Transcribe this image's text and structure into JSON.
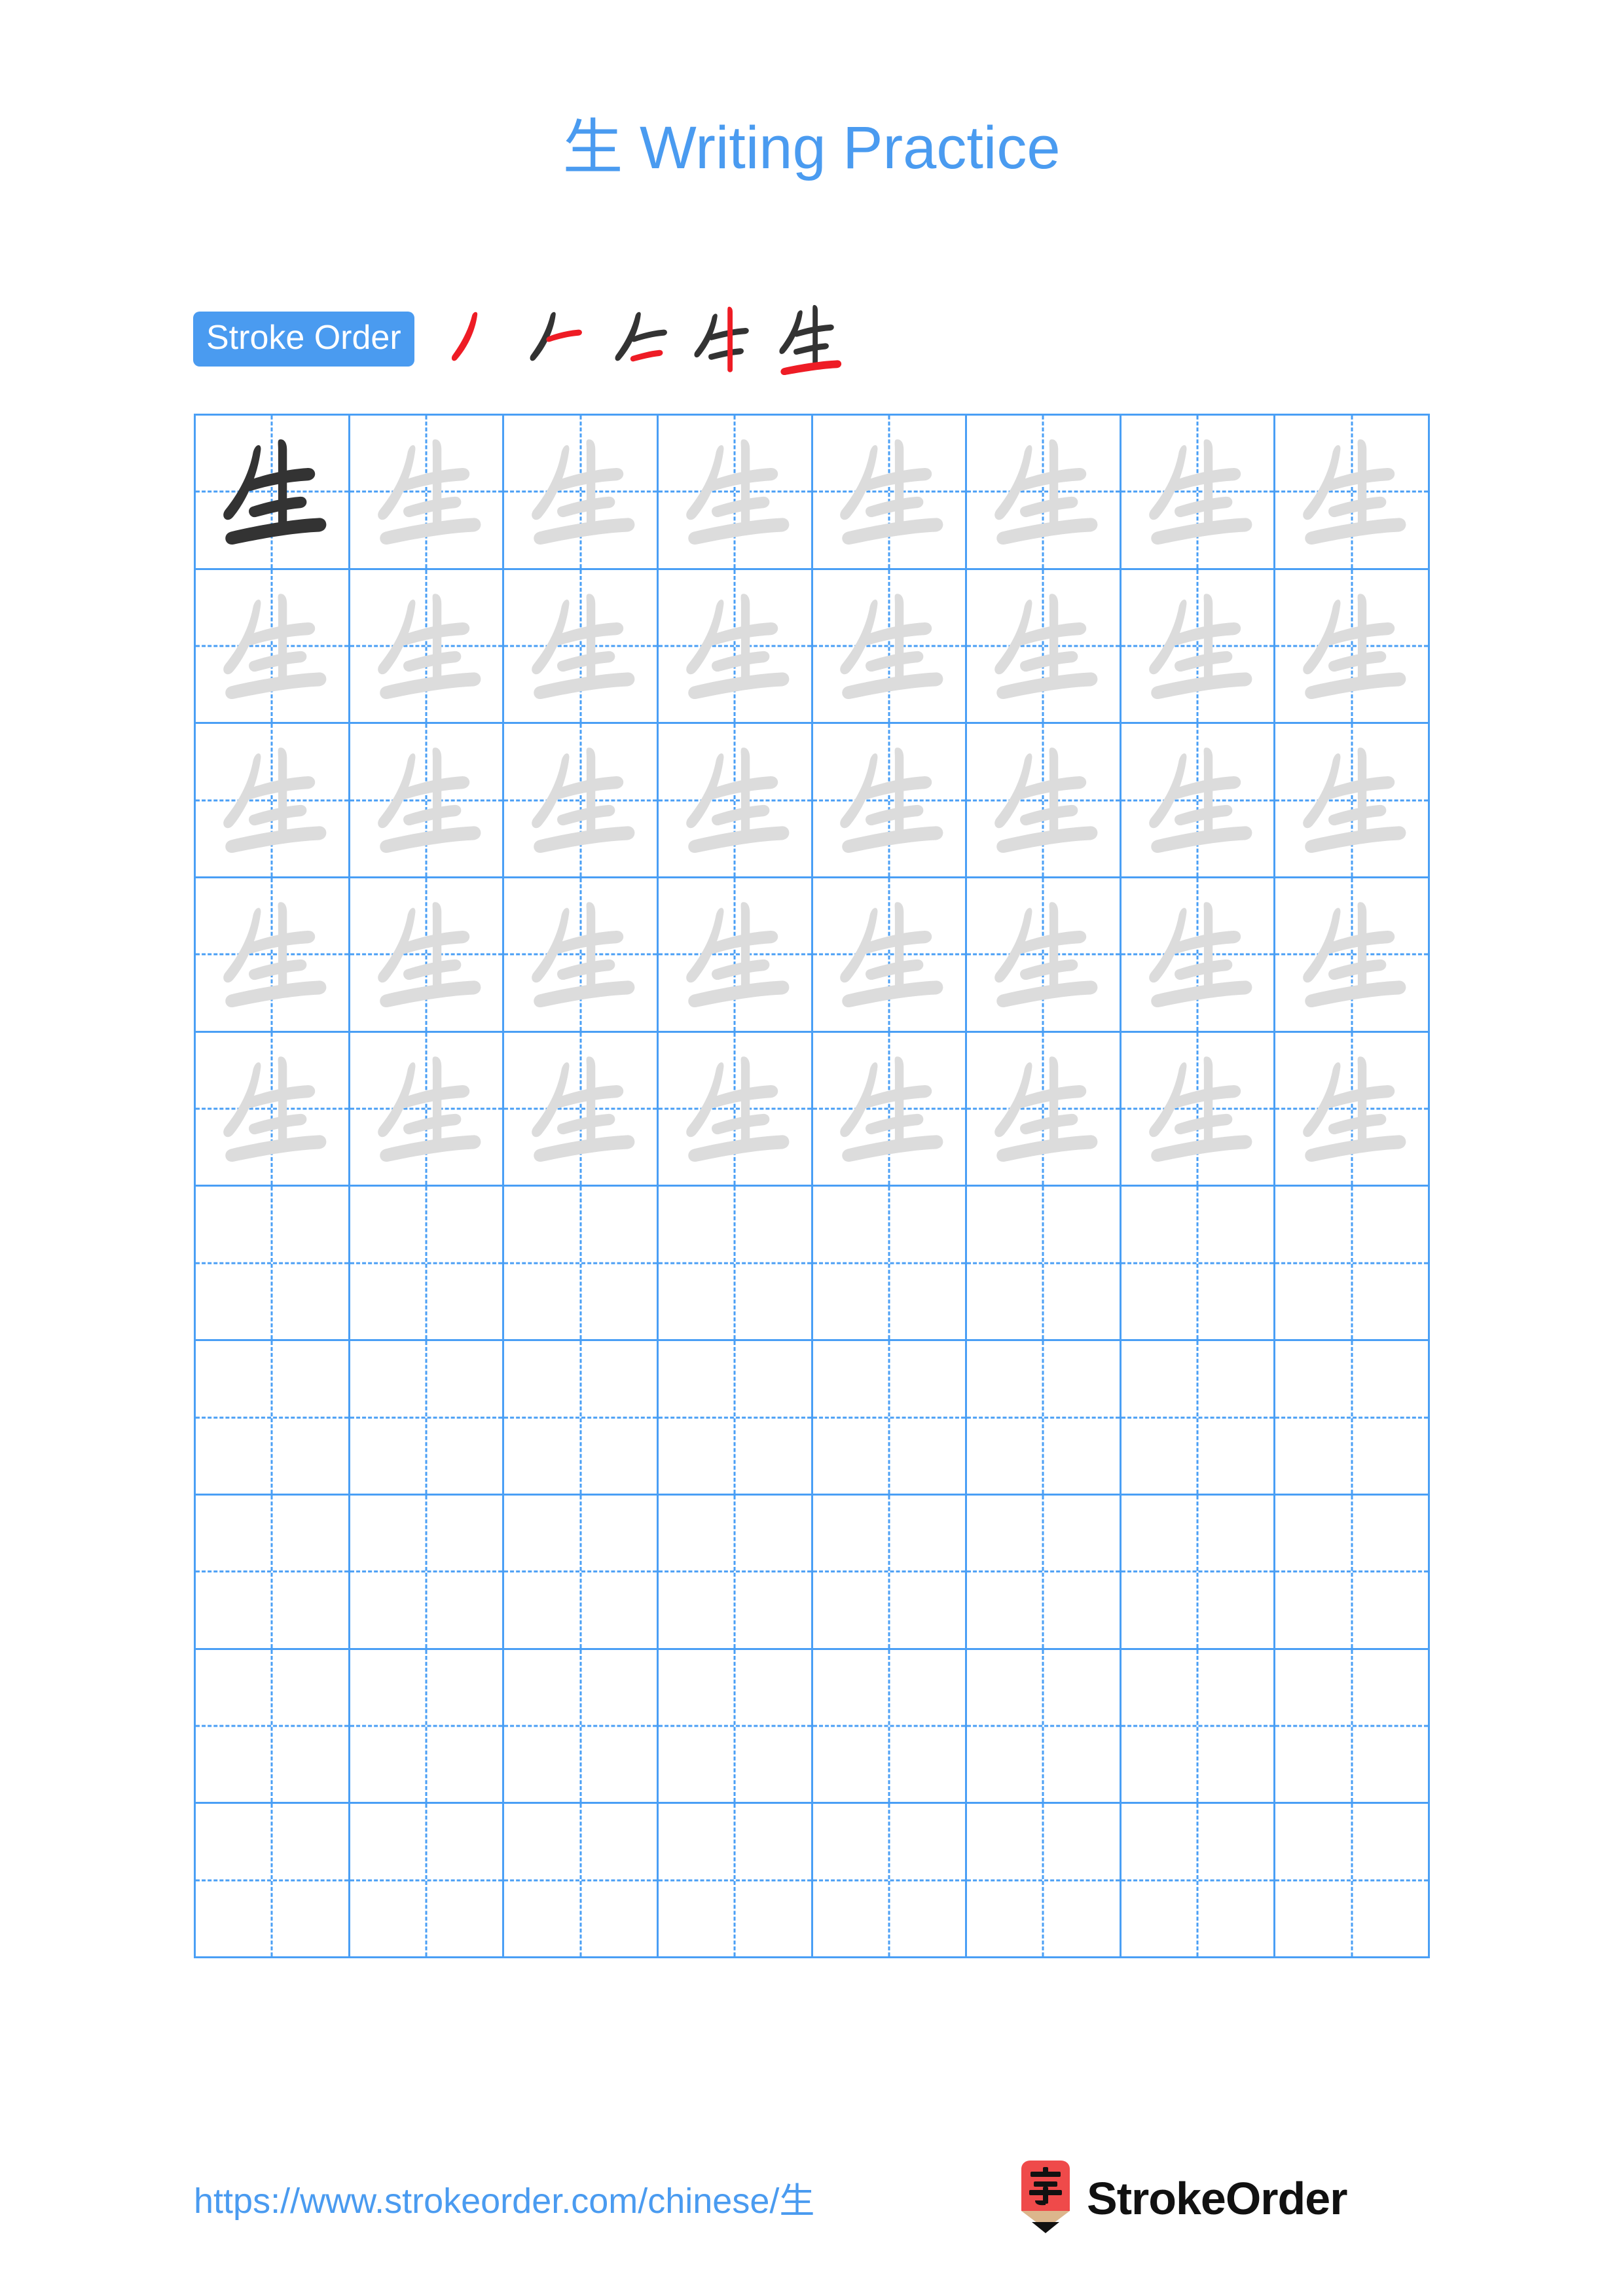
{
  "page": {
    "background": "#ffffff",
    "accent_blue": "#4a9bf0",
    "grid_blue": "#4a9ff5",
    "ink_dark": "#333333",
    "ink_light": "#dcdcdc",
    "stroke_highlight_red": "#ee1c25",
    "logo_red": "#ef4a4a",
    "logo_wood": "#dcb68c"
  },
  "header": {
    "character": "生",
    "title_suffix": " Writing Practice",
    "title_full": "生 Writing Practice"
  },
  "stroke_order": {
    "badge_label": "Stroke Order",
    "stroke_count": 5,
    "steps": [
      {
        "index": 1,
        "new_stroke": "撇 (ノ)",
        "strokes_shown": 1
      },
      {
        "index": 2,
        "new_stroke": "横 (一)",
        "strokes_shown": 2
      },
      {
        "index": 3,
        "new_stroke": "横 (一)",
        "strokes_shown": 3
      },
      {
        "index": 4,
        "new_stroke": "竖 (丨)",
        "strokes_shown": 4
      },
      {
        "index": 5,
        "new_stroke": "横 (一)",
        "strokes_shown": 5
      }
    ]
  },
  "practice_grid": {
    "columns": 8,
    "rows": 10,
    "character": "生",
    "rows_data": [
      {
        "row": 1,
        "cells": [
          "dark",
          "light",
          "light",
          "light",
          "light",
          "light",
          "light",
          "light"
        ]
      },
      {
        "row": 2,
        "cells": [
          "light",
          "light",
          "light",
          "light",
          "light",
          "light",
          "light",
          "light"
        ]
      },
      {
        "row": 3,
        "cells": [
          "light",
          "light",
          "light",
          "light",
          "light",
          "light",
          "light",
          "light"
        ]
      },
      {
        "row": 4,
        "cells": [
          "light",
          "light",
          "light",
          "light",
          "light",
          "light",
          "light",
          "light"
        ]
      },
      {
        "row": 5,
        "cells": [
          "light",
          "light",
          "light",
          "light",
          "light",
          "light",
          "light",
          "light"
        ]
      },
      {
        "row": 6,
        "cells": [
          "empty",
          "empty",
          "empty",
          "empty",
          "empty",
          "empty",
          "empty",
          "empty"
        ]
      },
      {
        "row": 7,
        "cells": [
          "empty",
          "empty",
          "empty",
          "empty",
          "empty",
          "empty",
          "empty",
          "empty"
        ]
      },
      {
        "row": 8,
        "cells": [
          "empty",
          "empty",
          "empty",
          "empty",
          "empty",
          "empty",
          "empty",
          "empty"
        ]
      },
      {
        "row": 9,
        "cells": [
          "empty",
          "empty",
          "empty",
          "empty",
          "empty",
          "empty",
          "empty",
          "empty"
        ]
      },
      {
        "row": 10,
        "cells": [
          "empty",
          "empty",
          "empty",
          "empty",
          "empty",
          "empty",
          "empty",
          "empty"
        ]
      }
    ]
  },
  "footer": {
    "url": "https://www.strokeorder.com/chinese/生",
    "brand_name": "StrokeOrder",
    "brand_mark_character": "字"
  }
}
